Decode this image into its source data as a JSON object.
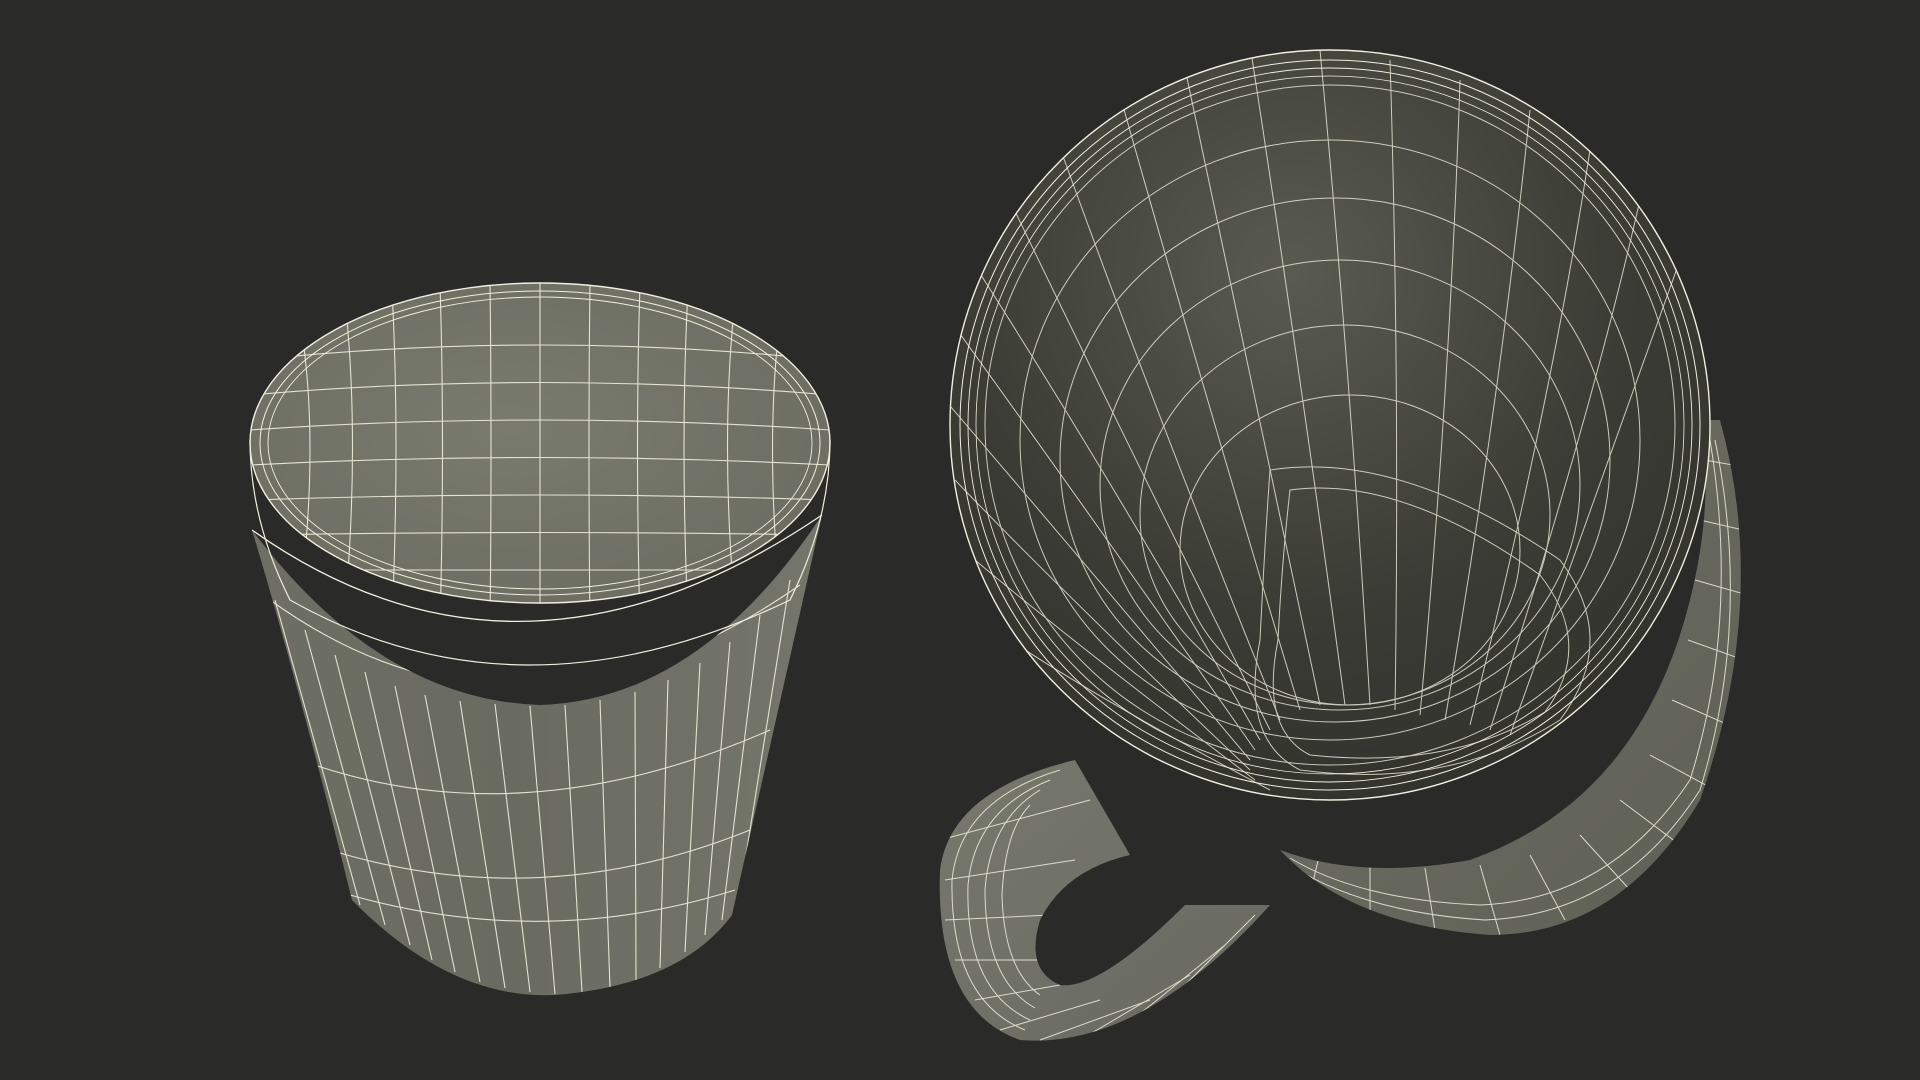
{
  "scene": {
    "subject": "wireframe-coffee-cup-and-lid",
    "colors": {
      "background": "#2a2a28",
      "wire": "#f1efdc",
      "surface_light": "#7f8073",
      "surface_mid": "#6b6c61",
      "surface_dark": "#41423b",
      "inner_dark": "#33342f"
    }
  }
}
